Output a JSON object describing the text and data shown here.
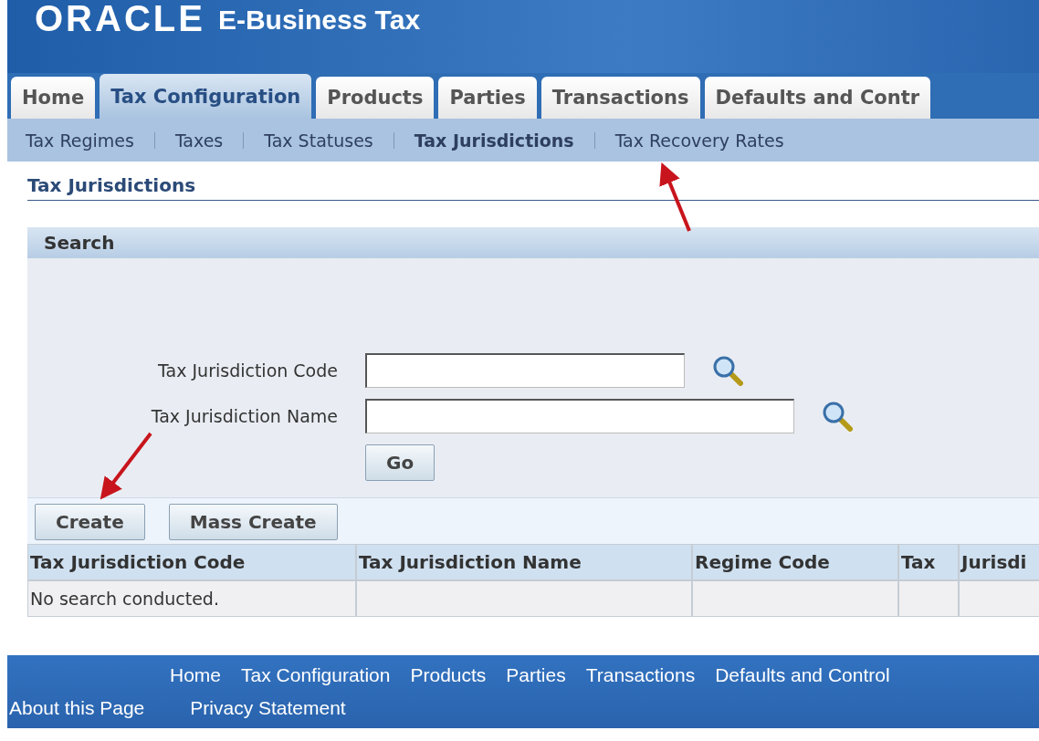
{
  "header": {
    "logo": "ORACLE",
    "title": "E-Business Tax"
  },
  "tabs": [
    {
      "label": "Home",
      "selected": false
    },
    {
      "label": "Tax Configuration",
      "selected": true
    },
    {
      "label": "Products",
      "selected": false
    },
    {
      "label": "Parties",
      "selected": false
    },
    {
      "label": "Transactions",
      "selected": false
    },
    {
      "label": "Defaults and Contr",
      "selected": false
    }
  ],
  "subtabs": [
    {
      "label": "Tax Regimes",
      "selected": false
    },
    {
      "label": "Taxes",
      "selected": false
    },
    {
      "label": "Tax Statuses",
      "selected": false
    },
    {
      "label": "Tax Jurisdictions",
      "selected": true
    },
    {
      "label": "Tax Recovery Rates",
      "selected": false
    }
  ],
  "page_title": "Tax Jurisdictions",
  "search": {
    "title": "Search",
    "fields": [
      {
        "label": "Tax Jurisdiction Code"
      },
      {
        "label": "Tax Jurisdiction Name"
      }
    ],
    "go_button": "Go"
  },
  "buttons": [
    "Create",
    "Mass Create"
  ],
  "table": {
    "columns": [
      "Tax Jurisdiction Code",
      "Tax Jurisdiction Name",
      "Regime Code",
      "Tax",
      "Jurisdi"
    ],
    "empty_message": "No search conducted."
  },
  "footer": {
    "links": [
      "Home",
      "Tax Configuration",
      "Products",
      "Parties",
      "Transactions",
      "Defaults and Control"
    ],
    "bottom_links": [
      "About this Page",
      "Privacy Statement"
    ]
  }
}
